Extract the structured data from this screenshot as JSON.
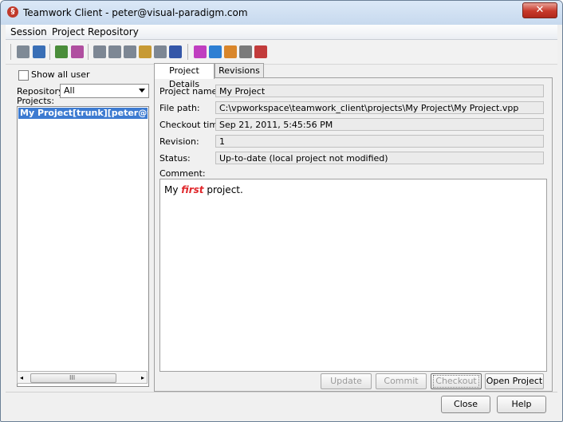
{
  "window": {
    "title": "Teamwork Client - peter@visual-paradigm.com",
    "close_label": "✕"
  },
  "menu": [
    "Session",
    "Project",
    "Repository"
  ],
  "toolbar": {
    "icons": [
      {
        "name": "commit-icon",
        "color": "#7f8a96"
      },
      {
        "name": "open-icon",
        "color": "#3a6fb6"
      },
      {
        "name": "import-icon",
        "color": "#4a8d3a"
      },
      {
        "name": "export-icon",
        "color": "#b04fa0"
      },
      {
        "name": "branch-icon",
        "color": "#7d8794"
      },
      {
        "name": "tag-icon",
        "color": "#7d8794"
      },
      {
        "name": "merge-icon",
        "color": "#7d8794"
      },
      {
        "name": "folder-icon",
        "color": "#c79a34"
      },
      {
        "name": "copy-icon",
        "color": "#7d8794"
      },
      {
        "name": "search-icon",
        "color": "#3557a8"
      },
      {
        "name": "flag-icon",
        "color": "#c03ec0"
      },
      {
        "name": "update-arrow-icon",
        "color": "#2e7fd3"
      },
      {
        "name": "revert-arrow-icon",
        "color": "#d9862b"
      },
      {
        "name": "lock-icon",
        "color": "#7a7a7a"
      },
      {
        "name": "delete-icon",
        "color": "#c23b3b"
      }
    ]
  },
  "left": {
    "show_all_user_label": "Show all user",
    "repository_label": "Repository:",
    "repository_value": "All",
    "projects_label": "Projects:",
    "projects": [
      "My Project[trunk][peter@visual-"
    ],
    "scroll_grip": "III",
    "scroll_left": "◂",
    "scroll_right": "▸"
  },
  "tabs": [
    "Project Details",
    "Revisions"
  ],
  "details": {
    "fields": [
      {
        "label": "Project name:",
        "value": "My Project"
      },
      {
        "label": "File path:",
        "value": "C:\\vpworkspace\\teamwork_client\\projects\\My Project\\My Project.vpp"
      },
      {
        "label": "Checkout time:",
        "value": "Sep 21, 2011, 5:45:56 PM"
      },
      {
        "label": "Revision:",
        "value": "1"
      },
      {
        "label": "Status:",
        "value": "Up-to-date (local project not modified)"
      }
    ],
    "comment_label": "Comment:",
    "comment_pre": "My ",
    "comment_em": "first",
    "comment_post": " project."
  },
  "actions": {
    "update": "Update",
    "commit": "Commit",
    "checkout": "Checkout",
    "open_project": "Open Project"
  },
  "footer": {
    "close": "Close",
    "help": "Help"
  }
}
